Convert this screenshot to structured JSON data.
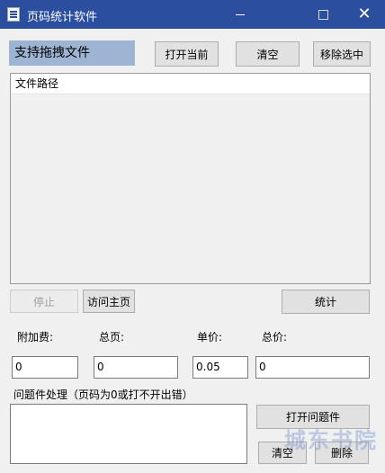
{
  "window": {
    "title": "页码统计软件",
    "close_glyph": "✕"
  },
  "drop_area_label": "支持拖拽文件",
  "toolbar": {
    "open_current": "打开当前",
    "clear": "清空",
    "remove_selected": "移除选中"
  },
  "file_list": {
    "column_header": "文件路径"
  },
  "controls": {
    "stop": "停止",
    "visit_home": "访问主页",
    "count": "统计"
  },
  "fields": {
    "surcharge": {
      "label": "附加费:",
      "value": "0"
    },
    "total_pages": {
      "label": "总页:",
      "value": "0"
    },
    "unit_price": {
      "label": "单价:",
      "value": "0.05"
    },
    "total_price": {
      "label": "总价:",
      "value": "0"
    }
  },
  "problem_section": {
    "label": "问题件处理（页码为0或打不开出错）",
    "open_problem_files": "打开问题件",
    "clear": "清空",
    "delete": "删除"
  },
  "watermark": "城东书院",
  "colors": {
    "titlebar": "#2b4f9e",
    "drop_area": "#9eb4d3"
  }
}
